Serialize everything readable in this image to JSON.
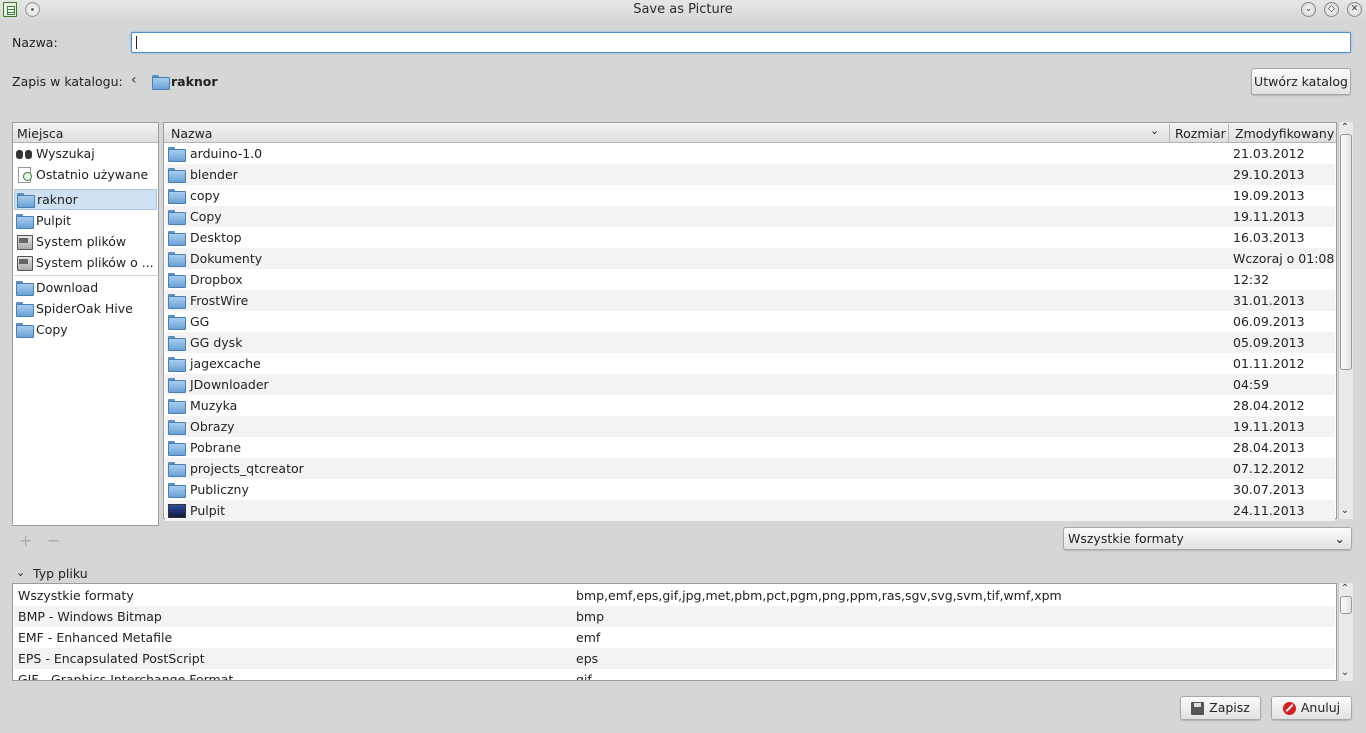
{
  "window": {
    "title": "Save as Picture"
  },
  "name_field": {
    "label": "Nazwa:",
    "value": ""
  },
  "location": {
    "label": "Zapis w katalogu:",
    "current": "raknor",
    "create_folder_label": "Utwórz katalog"
  },
  "places": {
    "header": "Miejsca",
    "items": [
      {
        "label": "Wyszukaj",
        "icon": "binoculars-icon"
      },
      {
        "label": "Ostatnio używane",
        "icon": "recent-icon"
      },
      {
        "label": "raknor",
        "icon": "home-folder-icon",
        "selected": true
      },
      {
        "label": "Pulpit",
        "icon": "folder-icon"
      },
      {
        "label": "System plików",
        "icon": "drive-icon"
      },
      {
        "label": "System plików o ...",
        "icon": "drive-icon"
      },
      {
        "label": "Download",
        "icon": "folder-icon"
      },
      {
        "label": "SpiderOak Hive",
        "icon": "folder-icon"
      },
      {
        "label": "Copy",
        "icon": "folder-icon"
      }
    ]
  },
  "files": {
    "columns": {
      "name": "Nazwa",
      "size": "Rozmiar",
      "modified": "Zmodyfikowany"
    },
    "rows": [
      {
        "name": "arduino-1.0",
        "modified": "21.03.2012"
      },
      {
        "name": "blender",
        "modified": "29.10.2013"
      },
      {
        "name": "copy",
        "modified": "19.09.2013"
      },
      {
        "name": "Copy",
        "modified": "19.11.2013"
      },
      {
        "name": "Desktop",
        "modified": "16.03.2013"
      },
      {
        "name": "Dokumenty",
        "modified": "Wczoraj o 01:08"
      },
      {
        "name": "Dropbox",
        "modified": "12:32"
      },
      {
        "name": "FrostWire",
        "modified": "31.01.2013"
      },
      {
        "name": "GG",
        "modified": "06.09.2013"
      },
      {
        "name": "GG dysk",
        "modified": "05.09.2013"
      },
      {
        "name": "jagexcache",
        "modified": "01.11.2012"
      },
      {
        "name": "JDownloader",
        "modified": "04:59"
      },
      {
        "name": "Muzyka",
        "modified": "28.04.2012"
      },
      {
        "name": "Obrazy",
        "modified": "19.11.2013"
      },
      {
        "name": "Pobrane",
        "modified": "28.04.2013"
      },
      {
        "name": "projects_qtcreator",
        "modified": "07.12.2012"
      },
      {
        "name": "Publiczny",
        "modified": "30.07.2013"
      },
      {
        "name": "Pulpit",
        "modified": "24.11.2013"
      }
    ]
  },
  "filter": {
    "selected": "Wszystkie formaty"
  },
  "file_types": {
    "header": "Typ pliku",
    "rows": [
      {
        "name": "Wszystkie formaty",
        "ext": "bmp,emf,eps,gif,jpg,met,pbm,pct,pgm,png,ppm,ras,sgv,svg,svm,tif,wmf,xpm"
      },
      {
        "name": "BMP - Windows Bitmap",
        "ext": "bmp"
      },
      {
        "name": "EMF - Enhanced Metafile",
        "ext": "emf"
      },
      {
        "name": "EPS - Encapsulated PostScript",
        "ext": "eps"
      },
      {
        "name": "GIF - Graphics Interchange Format",
        "ext": "gif"
      }
    ]
  },
  "buttons": {
    "save": "Zapisz",
    "cancel": "Anuluj"
  },
  "colors": {
    "accent": "#4a8ed0",
    "selection": "#cfe0f3",
    "folder": "#6aa2d6",
    "cancel_red": "#d42020"
  }
}
